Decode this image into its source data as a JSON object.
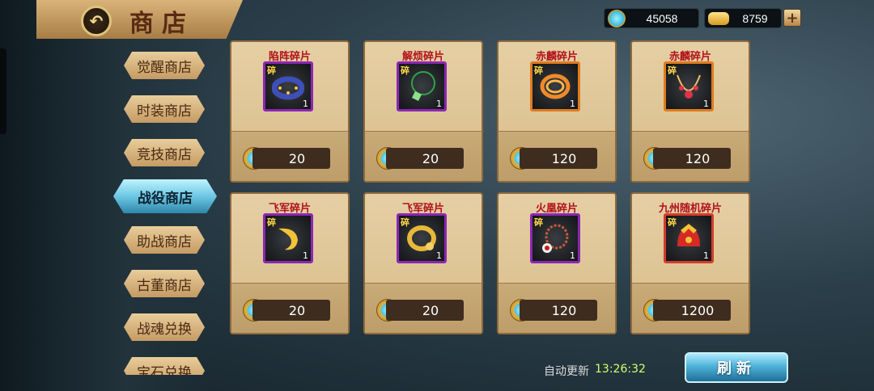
{
  "header": {
    "title": "商店",
    "back_icon": "back-arrow-icon",
    "gems": "45058",
    "ingots": "8759",
    "add_label": "+"
  },
  "sidebar": {
    "tabs": [
      {
        "label": "觉醒商店"
      },
      {
        "label": "时装商店"
      },
      {
        "label": "竞技商店"
      },
      {
        "label": "战役商店"
      },
      {
        "label": "助战商店"
      },
      {
        "label": "古董商店"
      },
      {
        "label": "战魂兑换"
      },
      {
        "label": "宝石兑换"
      }
    ],
    "active_tab": "战役商店"
  },
  "items": [
    {
      "name": "陷阵碎片",
      "frag": "碎",
      "qty": "1",
      "price": "20",
      "icon": "bracelet-icon"
    },
    {
      "name": "解烦碎片",
      "frag": "碎",
      "qty": "1",
      "price": "20",
      "icon": "pendant-icon"
    },
    {
      "name": "赤麟碎片",
      "frag": "碎",
      "qty": "1",
      "price": "120",
      "icon": "coil-ring-icon"
    },
    {
      "name": "赤麟碎片",
      "frag": "碎",
      "qty": "1",
      "price": "120",
      "icon": "necklace-icon"
    },
    {
      "name": "飞军碎片",
      "frag": "碎",
      "qty": "1",
      "price": "20",
      "icon": "flame-ornament-icon"
    },
    {
      "name": "飞军碎片",
      "frag": "碎",
      "qty": "1",
      "price": "20",
      "icon": "gold-ring-icon"
    },
    {
      "name": "火凰碎片",
      "frag": "碎",
      "qty": "1",
      "price": "120",
      "icon": "bead-necklace-icon"
    },
    {
      "name": "九州随机碎片",
      "frag": "碎",
      "qty": "1",
      "price": "1200",
      "icon": "helmet-icon"
    }
  ],
  "footer": {
    "auto_refresh_label": "自动更新",
    "auto_refresh_time": "13:26:32",
    "refresh_button": "刷新"
  },
  "colors": {
    "item_name": "#b0121a",
    "accent_blue": "#4fb2d8",
    "timer": "#d7ff6a"
  }
}
